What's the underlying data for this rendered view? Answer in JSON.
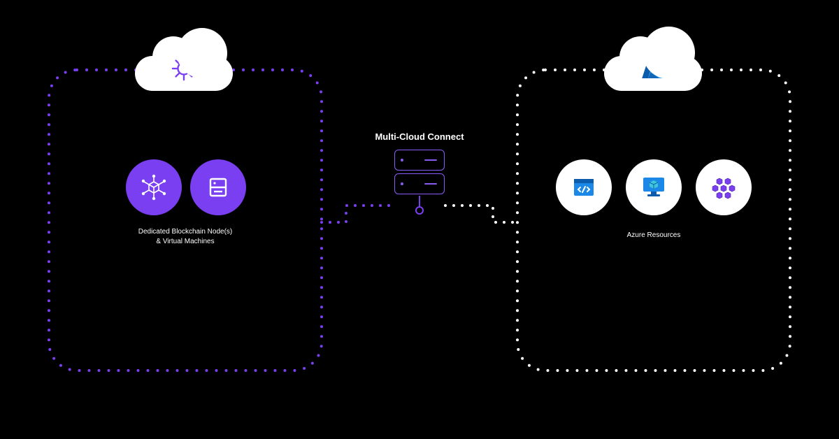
{
  "diagram": {
    "left_panel": {
      "cloud_icon": "kubernetes-cog",
      "items": [
        {
          "icon": "blockchain-cube",
          "bg": "#7b3ff2"
        },
        {
          "icon": "server-rack",
          "bg": "#7b3ff2"
        }
      ],
      "caption_line1": "Dedicated Blockchain Node(s)",
      "caption_line2": "& Virtual Machines",
      "border_color": "#7b3ff2"
    },
    "center": {
      "title": "Multi-Cloud Connect",
      "icon": "server-stack",
      "connector_color_left": "#7b3ff2",
      "connector_color_right": "#ffffff"
    },
    "right_panel": {
      "cloud_icon": "azure-logo",
      "items": [
        {
          "icon": "code-browser",
          "bg": "#ffffff"
        },
        {
          "icon": "monitor-cube",
          "bg": "#ffffff"
        },
        {
          "icon": "hex-cluster",
          "bg": "#ffffff"
        }
      ],
      "caption": "Azure Resources",
      "border_color": "#ffffff"
    }
  },
  "colors": {
    "purple": "#7b3ff2",
    "white": "#ffffff",
    "black": "#000000",
    "azure_blue_dark": "#0b5cad",
    "azure_blue_light": "#2ea0f4"
  }
}
